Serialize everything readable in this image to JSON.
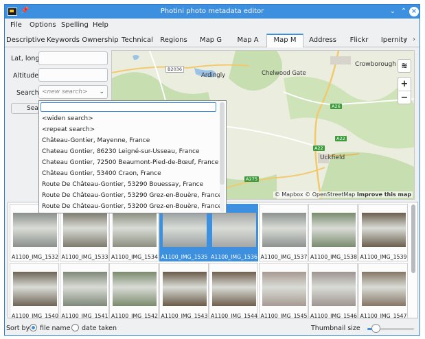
{
  "window": {
    "title": "Photini photo metadata editor"
  },
  "menu": [
    "File",
    "Options",
    "Spelling",
    "Help"
  ],
  "tabs": [
    "Descriptive",
    "Keywords",
    "Ownership",
    "Technical",
    "Regions",
    "Map G",
    "Map A",
    "Map M",
    "Address",
    "Flickr",
    "Ipernity"
  ],
  "active_tab": "Map M",
  "form": {
    "lat_long_label": "Lat, long",
    "altitude_label": "Altitude",
    "search_label": "Search",
    "search_placeholder": "<new search>",
    "search_button": "Search"
  },
  "dropdown": {
    "items": [
      "<widen search>",
      "<repeat search>",
      "Château-Gontier, Mayenne, France",
      "Chateau Gontier, 86230 Leigné-sur-Usseau, France",
      "Chateau Gontier, 72500 Beaumont-Pied-de-Bœuf, France",
      "Château Gontier, 53400 Craon, France",
      "Route De Château-Gontier, 53290 Bouessay, France",
      "Route De Château-Gontier, 53290 Grez-en-Bouère, France",
      "Route De Château-Gontier, 53200 Grez-en-Bouère, France"
    ]
  },
  "map": {
    "places": [
      "Crowborough",
      "Ardingly",
      "Chelwood Gate",
      "Uckfield"
    ],
    "roads": [
      "B2036",
      "A26",
      "A22",
      "A22",
      "A275"
    ],
    "attribution": {
      "mapbox": "© Mapbox",
      "osm": "© OpenStreetMap",
      "improve": "Improve this map"
    },
    "zoom_in": "+",
    "zoom_out": "−"
  },
  "thumbnails": [
    {
      "caption": "A1100_IMG_1532",
      "selected": false,
      "color": "#8a8f8c"
    },
    {
      "caption": "A1100_IMG_1533",
      "selected": false,
      "color": "#7d7a6e"
    },
    {
      "caption": "A1100_IMG_1534",
      "selected": false,
      "color": "#8b8e80"
    },
    {
      "caption": "A1100_IMG_1535",
      "selected": true,
      "color": "#9aa0a2"
    },
    {
      "caption": "A1100_IMG_1536",
      "selected": true,
      "color": "#a4a7a6"
    },
    {
      "caption": "A1100_IMG_1537",
      "selected": false,
      "color": "#8d9290"
    },
    {
      "caption": "A1100_IMG_1538",
      "selected": false,
      "color": "#7a8a6e"
    },
    {
      "caption": "A1100_IMG_1539",
      "selected": false,
      "color": "#6b5e4e"
    },
    {
      "caption": "A1100_IMG_1540",
      "selected": false,
      "color": "#6e6456"
    },
    {
      "caption": "A1100_IMG_1541",
      "selected": false,
      "color": "#7f8878"
    },
    {
      "caption": "A1100_IMG_1542",
      "selected": false,
      "color": "#7b8a6c"
    },
    {
      "caption": "A1100_IMG_1543",
      "selected": false,
      "color": "#6a5a48"
    },
    {
      "caption": "A1100_IMG_1544",
      "selected": false,
      "color": "#705f4e"
    },
    {
      "caption": "A1100_IMG_1545",
      "selected": false,
      "color": "#a79a92"
    },
    {
      "caption": "A1100_IMG_1546",
      "selected": false,
      "color": "#9e9490"
    },
    {
      "caption": "A1100_IMG_1547",
      "selected": false,
      "color": "#857565"
    }
  ],
  "statusbar": {
    "sort_by": "Sort by",
    "file_name": "file name",
    "date_taken": "date taken",
    "sort_selected": "file name",
    "thumbnail_size": "Thumbnail size",
    "thumbnail_size_fraction": 0.18
  },
  "colors": {
    "accent": "#3d8fe0",
    "map_water": "#9cc3e6",
    "map_green": "#c7deb0"
  }
}
